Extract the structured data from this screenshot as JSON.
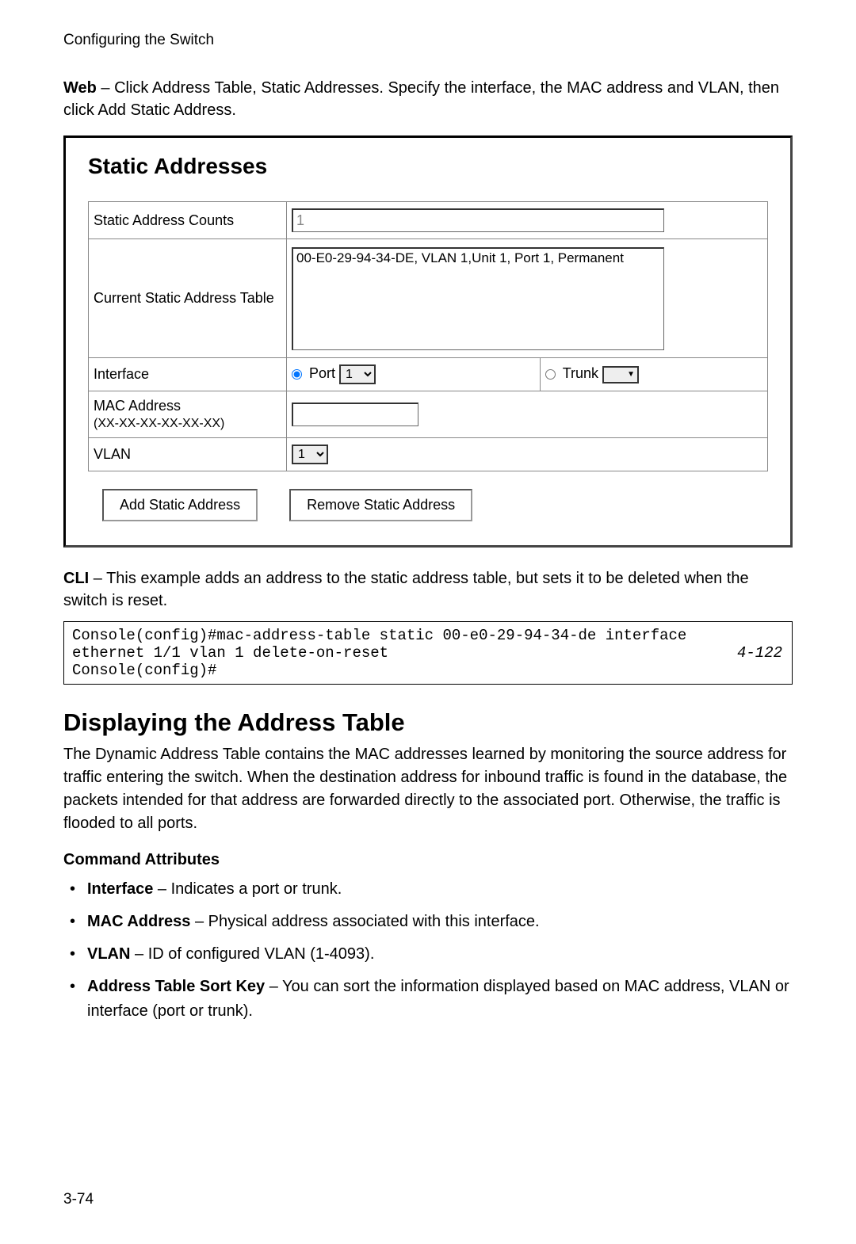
{
  "header": {
    "title": "Configuring the Switch"
  },
  "intro": {
    "lead": "Web",
    "text": " – Click Address Table, Static Addresses. Specify the interface, the MAC address and VLAN, then click Add Static Address."
  },
  "panel": {
    "title": "Static Addresses",
    "rows": {
      "counts_label": "Static Address Counts",
      "counts_value": "1",
      "table_label": "Current Static Address Table",
      "table_entry": "00-E0-29-94-34-DE, VLAN 1,Unit 1, Port 1, Permanent",
      "interface_label": "Interface",
      "port_label": "Port",
      "port_value": "1",
      "trunk_label": "Trunk",
      "mac_label": "MAC Address",
      "mac_hint": "(XX-XX-XX-XX-XX-XX)",
      "vlan_label": "VLAN",
      "vlan_value": "1"
    },
    "buttons": {
      "add": "Add Static Address",
      "remove": "Remove Static Address"
    }
  },
  "cli": {
    "lead": "CLI",
    "text": " – This example adds an address to the static address table, but sets it to be deleted when the switch is reset.",
    "line1": "Console(config)#mac-address-table static 00-e0-29-94-34-de interface",
    "line2": "  ethernet 1/1 vlan 1 delete-on-reset",
    "line3": "Console(config)#",
    "ref": "4-122"
  },
  "section": {
    "heading": "Displaying the Address Table",
    "body": "The Dynamic Address Table contains the MAC addresses learned by monitoring the source address for traffic entering the switch. When the destination address for inbound traffic is found in the database, the packets intended for that address are forwarded directly to the associated port. Otherwise, the traffic is flooded to all ports.",
    "sub": "Command Attributes",
    "attrs": [
      {
        "term": "Interface",
        "desc": " – Indicates a port or trunk."
      },
      {
        "term": "MAC Address",
        "desc": " – Physical address associated with this interface."
      },
      {
        "term": "VLAN",
        "desc": " – ID of configured VLAN (1-4093)."
      },
      {
        "term": "Address Table Sort Key",
        "desc": " – You can sort the information displayed based on MAC address, VLAN or interface (port or trunk)."
      }
    ]
  },
  "page_number": "3-74"
}
